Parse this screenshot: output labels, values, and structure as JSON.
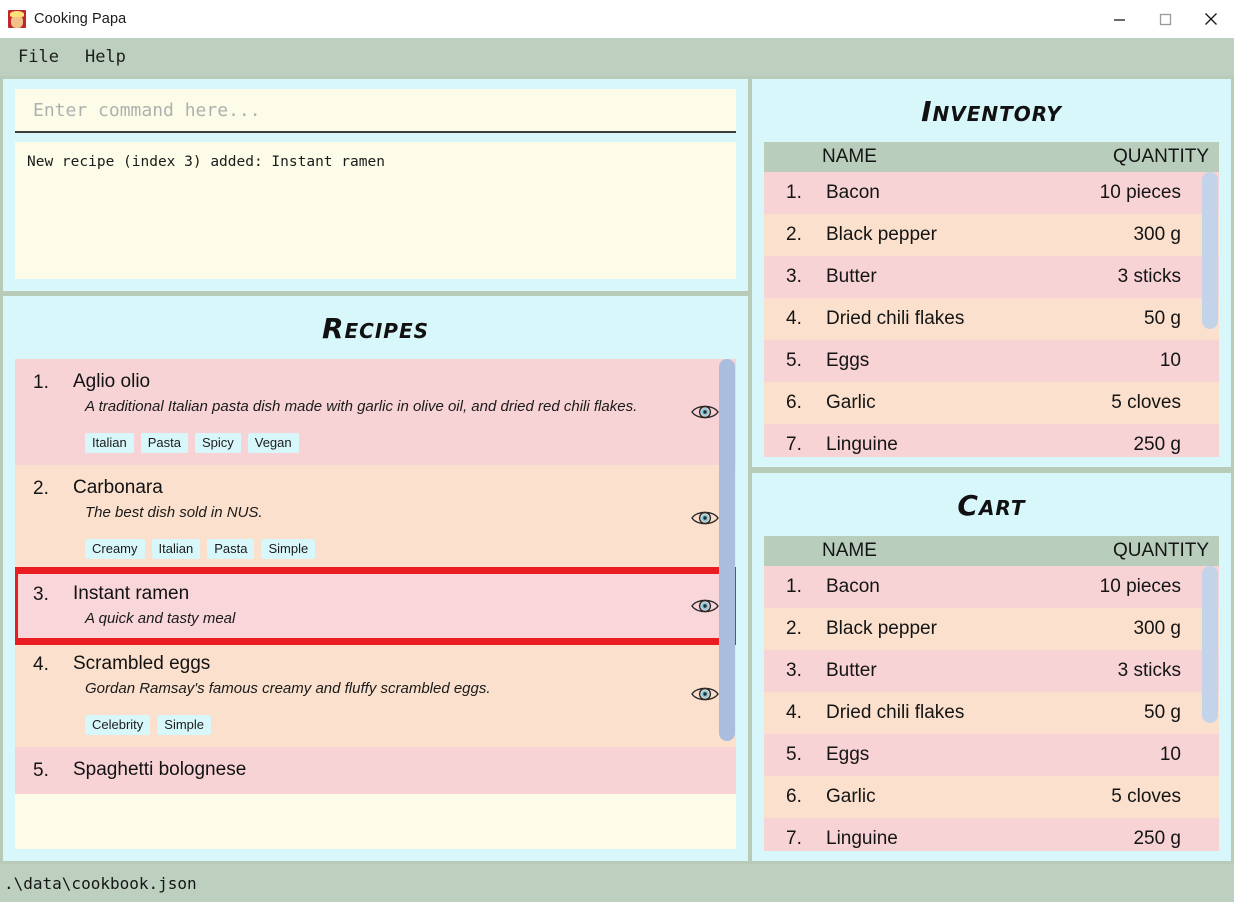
{
  "window": {
    "title": "Cooking Papa",
    "app_icon": "chef-app-icon",
    "minimize_label": "–",
    "maximize_label": "□",
    "close_label": "✕"
  },
  "menubar": {
    "items": [
      {
        "label": "File"
      },
      {
        "label": "Help"
      }
    ]
  },
  "console": {
    "input_value": "",
    "input_placeholder": "Enter command here...",
    "output": "New recipe (index 3) added: Instant ramen"
  },
  "recipes_panel": {
    "title": "Recipes",
    "eye_icon": "eye-icon",
    "scrollbar": {
      "thumb_top_pct": 0,
      "thumb_height_pct": 78
    },
    "items": [
      {
        "index": "1.",
        "name": "Aglio olio",
        "description": "A traditional Italian pasta dish made with garlic in olive oil, and dried red chili flakes.",
        "tags": [
          "Italian",
          "Pasta",
          "Spicy",
          "Vegan"
        ],
        "selected": false
      },
      {
        "index": "2.",
        "name": "Carbonara",
        "description": "The best dish sold in NUS.",
        "tags": [
          "Creamy",
          "Italian",
          "Pasta",
          "Simple"
        ],
        "selected": false
      },
      {
        "index": "3.",
        "name": "Instant ramen",
        "description": "A quick and tasty meal",
        "tags": [],
        "selected": true
      },
      {
        "index": "4.",
        "name": "Scrambled eggs",
        "description": "Gordan Ramsay's famous creamy and fluffy scrambled eggs.",
        "tags": [
          "Celebrity",
          "Simple"
        ],
        "selected": false
      },
      {
        "index": "5.",
        "name": "Spaghetti bolognese",
        "description": "",
        "tags": [],
        "selected": false
      }
    ]
  },
  "inventory_panel": {
    "title": "Inventory",
    "columns": {
      "name": "NAME",
      "quantity": "QUANTITY"
    },
    "scrollbar": {
      "thumb_top_pct": 0,
      "thumb_height_pct": 55
    },
    "rows": [
      {
        "index": "1.",
        "name": "Bacon",
        "quantity": "10 pieces"
      },
      {
        "index": "2.",
        "name": "Black pepper",
        "quantity": "300 g"
      },
      {
        "index": "3.",
        "name": "Butter",
        "quantity": "3 sticks"
      },
      {
        "index": "4.",
        "name": "Dried chili flakes",
        "quantity": "50 g"
      },
      {
        "index": "5.",
        "name": "Eggs",
        "quantity": "10"
      },
      {
        "index": "6.",
        "name": "Garlic",
        "quantity": "5 cloves"
      },
      {
        "index": "7.",
        "name": "Linguine",
        "quantity": "250 g"
      }
    ]
  },
  "cart_panel": {
    "title": "Cart",
    "columns": {
      "name": "NAME",
      "quantity": "QUANTITY"
    },
    "scrollbar": {
      "thumb_top_pct": 0,
      "thumb_height_pct": 55
    },
    "rows": [
      {
        "index": "1.",
        "name": "Bacon",
        "quantity": "10 pieces"
      },
      {
        "index": "2.",
        "name": "Black pepper",
        "quantity": "300 g"
      },
      {
        "index": "3.",
        "name": "Butter",
        "quantity": "3 sticks"
      },
      {
        "index": "4.",
        "name": "Dried chili flakes",
        "quantity": "50 g"
      },
      {
        "index": "5.",
        "name": "Eggs",
        "quantity": "10"
      },
      {
        "index": "6.",
        "name": "Garlic",
        "quantity": "5 cloves"
      },
      {
        "index": "7.",
        "name": "Linguine",
        "quantity": "250 g"
      }
    ]
  },
  "statusbar": {
    "file_path": ".\\data\\cookbook.json"
  },
  "colors": {
    "panel_bg": "#d8f7fa",
    "chrome": "#bdd0c0",
    "row_odd": "#f7d3d6",
    "row_even": "#fae0cd",
    "header_row": "#b8cdbb",
    "console_bg": "#fdfce8",
    "selection_outline": "#e81c21",
    "scrollbar_thumb": "#a9bede",
    "tag_bg": "#d8f7fa"
  }
}
